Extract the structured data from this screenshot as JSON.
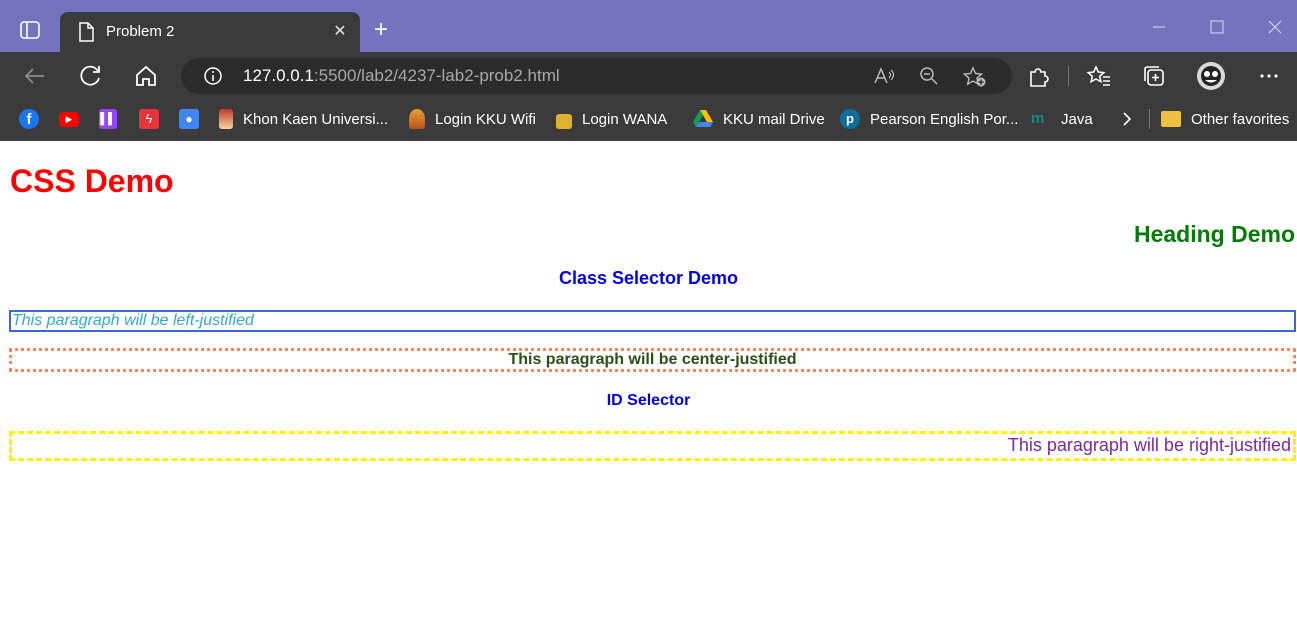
{
  "browser": {
    "tab_title": "Problem 2",
    "url_host": "127.0.0.1",
    "url_rest": ":5500/lab2/4237-lab2-prob2.html",
    "accent_color": "#7473bd",
    "favorites": [
      {
        "label": "",
        "icon": "facebook-icon",
        "color": "#1877f2"
      },
      {
        "label": "",
        "icon": "youtube-icon",
        "color": "#ff0000"
      },
      {
        "label": "",
        "icon": "twitch-icon",
        "color": "#9146ff"
      },
      {
        "label": "",
        "icon": "bolt-app-icon",
        "color": "#e8323c"
      },
      {
        "label": "",
        "icon": "contacts-icon",
        "color": "#4285f4"
      },
      {
        "label": "Khon Kaen Universi...",
        "icon": "kku-logo-icon"
      },
      {
        "label": "Login KKU Wifi",
        "icon": "kku-wifi-icon"
      },
      {
        "label": "Login WANA",
        "icon": "lock-icon"
      },
      {
        "label": "KKU mail Drive",
        "icon": "google-drive-icon"
      },
      {
        "label": "Pearson English Por...",
        "icon": "pearson-icon"
      },
      {
        "label": "Java",
        "icon": "java-site-icon"
      }
    ],
    "other_favorites": "Other favorites"
  },
  "page": {
    "title": "CSS Demo",
    "heading_demo": "Heading Demo",
    "class_selector": "Class Selector Demo",
    "left_paragraph": "This paragraph will be left-justified",
    "center_paragraph": "This paragraph will be center-justified",
    "id_selector": "ID Selector",
    "right_paragraph": "This paragraph will be right-justified"
  }
}
